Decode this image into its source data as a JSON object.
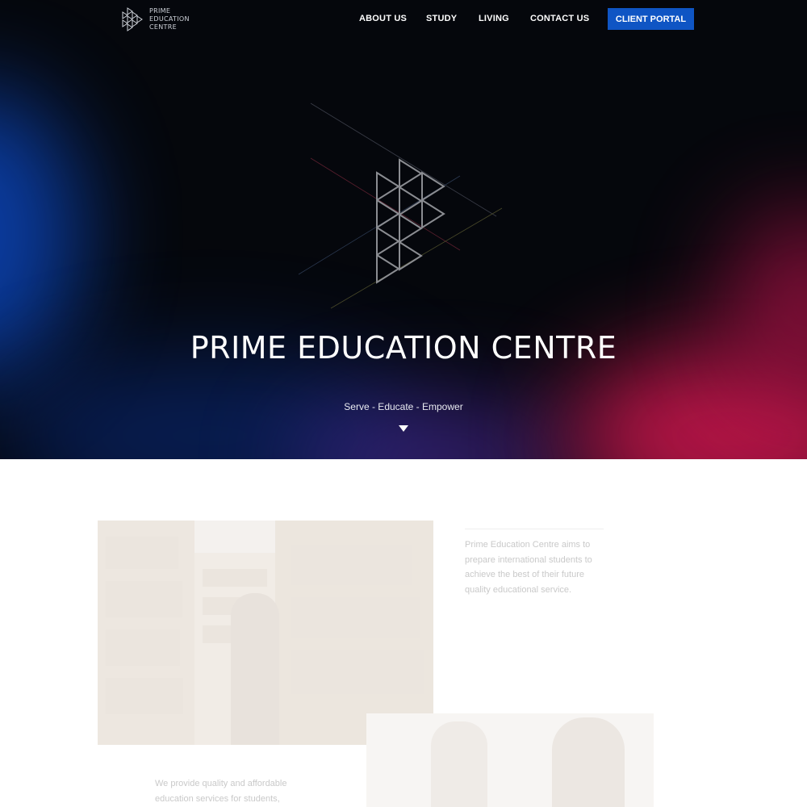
{
  "brand": {
    "logo_lines": [
      "PRIME",
      "EDUCATION",
      "CENTRE"
    ]
  },
  "nav": {
    "items": [
      {
        "label": "ABOUT US"
      },
      {
        "label": "STUDY"
      },
      {
        "label": "LIVING"
      },
      {
        "label": "CONTACT US"
      }
    ],
    "portal_label": "CLIENT PORTAL"
  },
  "hero": {
    "title": "PRIME EDUCATION CENTRE",
    "tagline": "Serve - Educate - Empower",
    "scroll_icon": "triangle-down-icon"
  },
  "intro": {
    "text": "Prime Education Centre aims to prepare international students to achieve the best of their future quality educational service."
  },
  "services": {
    "text": "We provide quality and affordable education services for students,"
  },
  "colors": {
    "accent": "#0f55c4",
    "hero_bg": "#05070c",
    "glow_blue": "#0b3fa8",
    "glow_red": "#c0164a",
    "body_text": "#c9c9c9"
  }
}
